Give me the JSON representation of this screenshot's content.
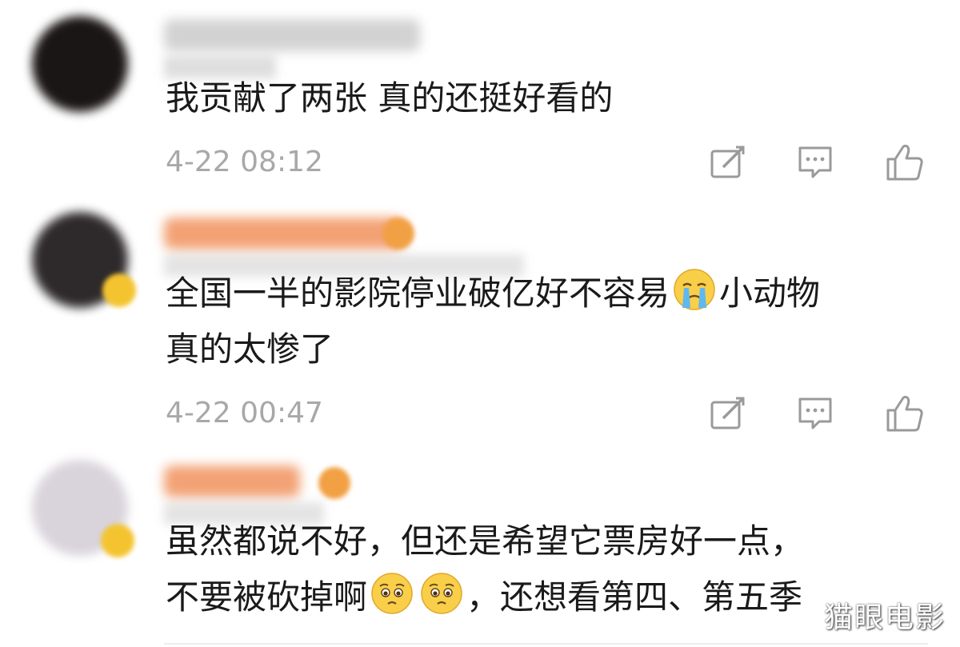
{
  "comments": [
    {
      "text_line1": "我贡献了两张 真的还挺好看的",
      "text_line2": "",
      "timestamp": "4-22 08:12",
      "avatar_color": "#1b1616",
      "name_color": "#c8c8c8"
    },
    {
      "text_line1": "全国一半的影院停业破亿好不容易",
      "text_line1_after": "小动物",
      "text_line2": "真的太惨了",
      "timestamp": "4-22 00:47",
      "avatar_color": "#2e2a2b",
      "name_color": "#f3a275",
      "emoji": "crying-face-icon"
    },
    {
      "text_line1": "虽然都说不好，但还是希望它票房好一点，",
      "text_line2_before": "不要被砍掉啊",
      "text_line2_after": "，还想看第四、第五季",
      "avatar_color": "#d9d4dc",
      "name_color": "#f3a275",
      "emoji": "pleading-face-icon"
    }
  ],
  "actions": [
    "share-icon",
    "comment-icon",
    "like-icon"
  ],
  "watermark": "猫眼电影",
  "colors": {
    "text": "#1a1a1a",
    "time": "#a8a8a8",
    "icon": "#9a9a9a",
    "badge": "#f4c430"
  }
}
